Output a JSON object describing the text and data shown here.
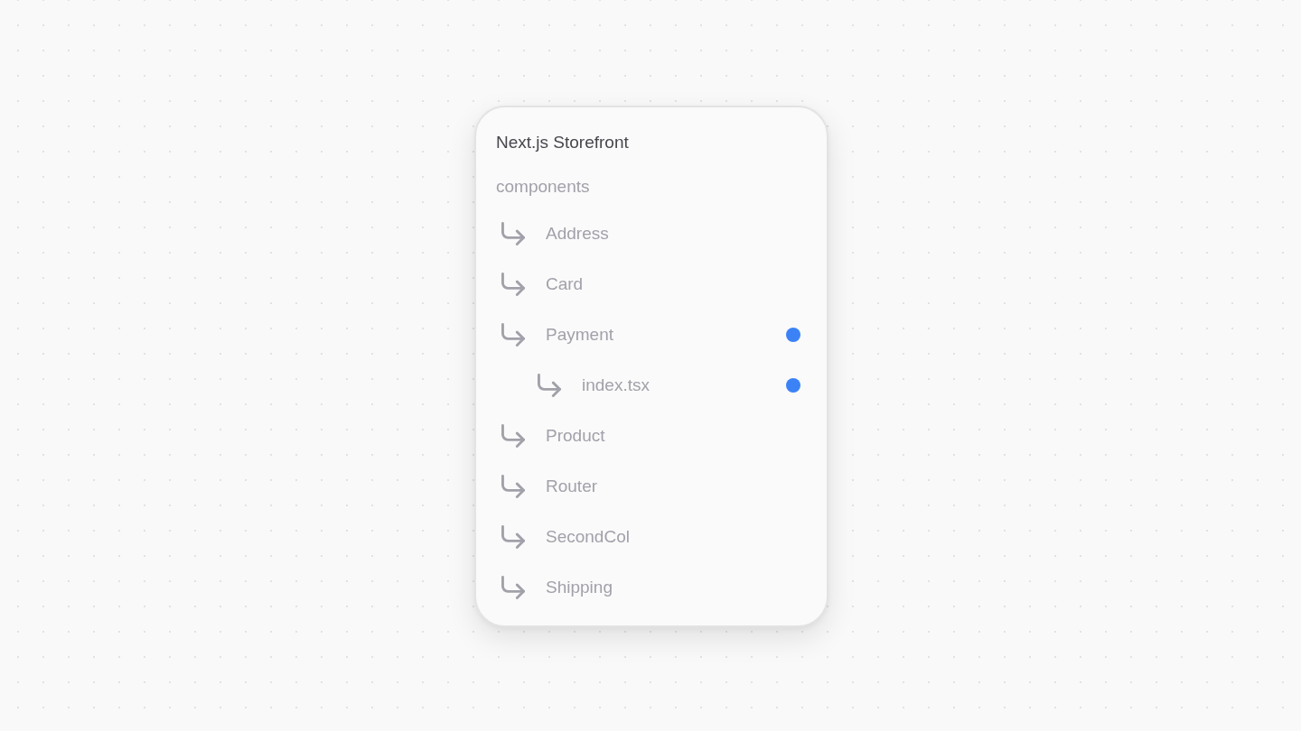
{
  "project": {
    "title": "Next.js Storefront"
  },
  "folder": {
    "name": "components",
    "children": [
      {
        "name": "Address",
        "modified": false
      },
      {
        "name": "Card",
        "modified": false
      },
      {
        "name": "Payment",
        "modified": true,
        "children": [
          {
            "name": "index.tsx",
            "modified": true
          }
        ]
      },
      {
        "name": "Product",
        "modified": false
      },
      {
        "name": "Router",
        "modified": false
      },
      {
        "name": "SecondCol",
        "modified": false
      },
      {
        "name": "Shipping",
        "modified": false
      }
    ]
  }
}
